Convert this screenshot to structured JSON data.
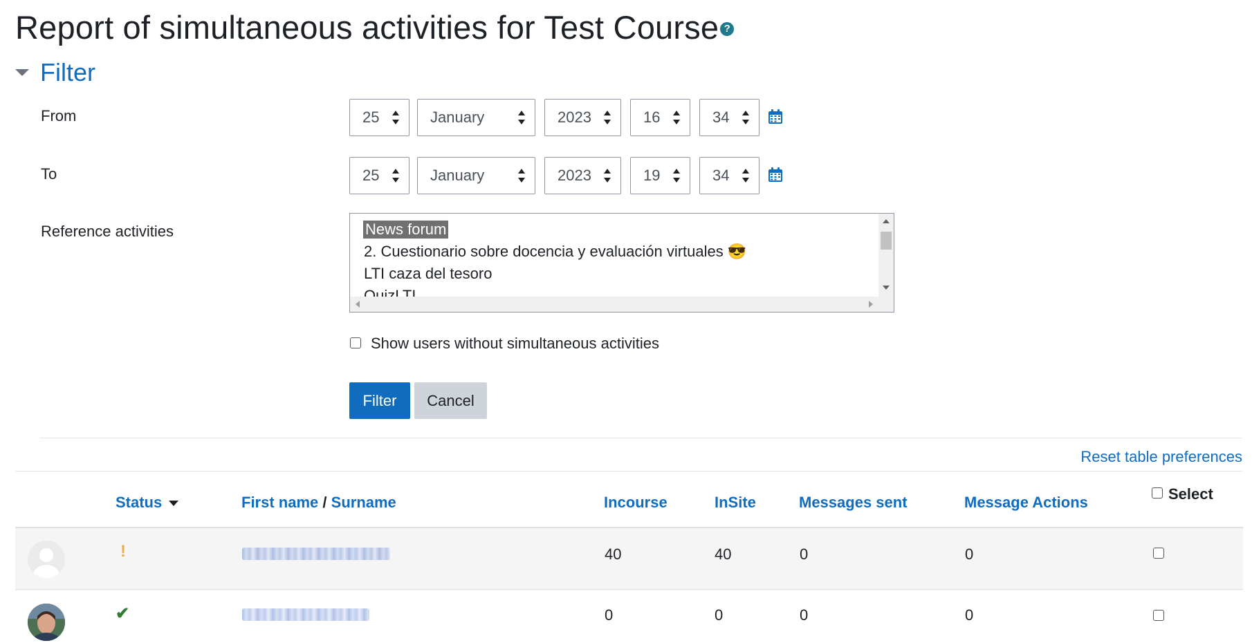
{
  "page": {
    "title": "Report of simultaneous activities for Test Course",
    "help_icon": "question-circle-icon"
  },
  "filter": {
    "heading": "Filter",
    "from": {
      "label": "From",
      "day": "25",
      "month": "January",
      "year": "2023",
      "hour": "16",
      "minute": "34"
    },
    "to": {
      "label": "To",
      "day": "25",
      "month": "January",
      "year": "2023",
      "hour": "19",
      "minute": "34"
    },
    "reference_activities": {
      "label": "Reference activities",
      "options": [
        {
          "text": "News forum",
          "selected": true
        },
        {
          "text": "2. Cuestionario sobre docencia y evaluación virtuales 😎",
          "selected": false
        },
        {
          "text": "LTI caza del tesoro",
          "selected": false
        },
        {
          "text": "QuizLTI",
          "selected": false
        }
      ]
    },
    "show_without_label": "Show users without simultaneous activities",
    "show_without_checked": false,
    "filter_button": "Filter",
    "cancel_button": "Cancel"
  },
  "table": {
    "reset_label": "Reset table preferences",
    "headers": {
      "status": "Status",
      "first_name": "First name",
      "name_sep": "/",
      "surname": "Surname",
      "incourse": "Incourse",
      "insite": "InSite",
      "messages_sent": "Messages sent",
      "message_actions": "Message Actions",
      "select": "Select"
    },
    "rows": [
      {
        "status": "warning",
        "status_glyph": "!",
        "status_color": "#f0ad4e",
        "incourse": "40",
        "insite": "40",
        "messages_sent": "0",
        "message_actions": "0"
      },
      {
        "status": "ok",
        "status_glyph": "✔",
        "status_color": "#357a32",
        "incourse": "0",
        "insite": "0",
        "messages_sent": "0",
        "message_actions": "0"
      }
    ]
  },
  "colors": {
    "accent": "#0f6cbf",
    "text": "#1d2125",
    "row_alt": "#f5f5f5"
  }
}
